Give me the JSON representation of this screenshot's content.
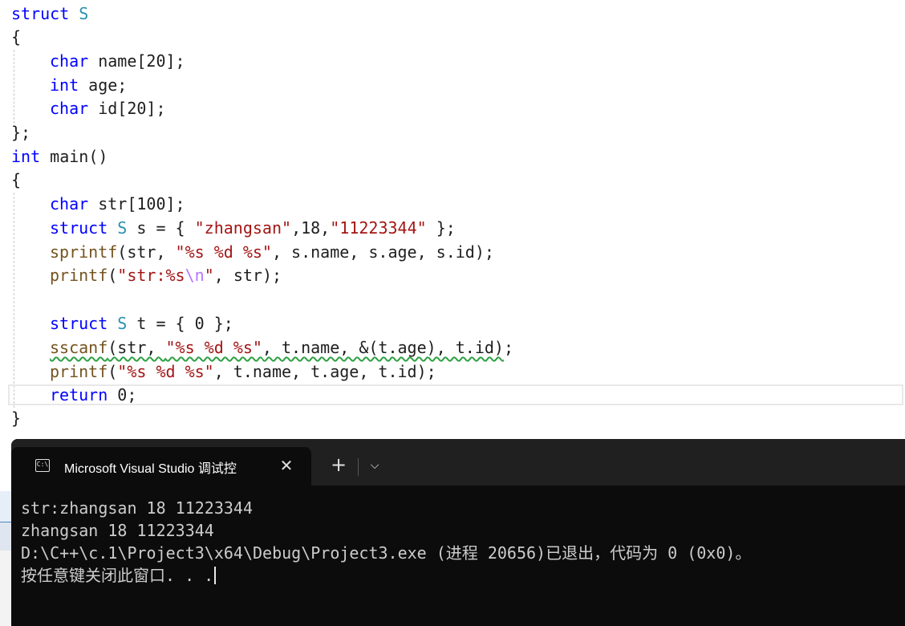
{
  "editor": {
    "lines": [
      {
        "kw": "struct",
        "ty": "S"
      },
      {
        "brace_open": "{"
      },
      {
        "kw": "char",
        "rest": " name[20];"
      },
      {
        "kw": "int",
        "rest": " age;"
      },
      {
        "kw": "char",
        "rest": " id[20];"
      },
      {
        "brace_close": "};"
      },
      {
        "kw": "int",
        "rest": " main()"
      },
      {
        "brace_open": "{"
      },
      {
        "kw": "char",
        "rest": " str[100];"
      },
      {
        "kw": "struct",
        "ty": "S",
        "p1": " s = { ",
        "s1": "\"zhangsan\"",
        "p2": ",18,",
        "s2": "\"11223344\"",
        "p3": " };"
      },
      {
        "fn": "sprintf",
        "p1": "(str, ",
        "s1": "\"%s %d %s\"",
        "p2": ", s.name, s.age, s.id);"
      },
      {
        "fn": "printf",
        "p1": "(",
        "s1": "\"str:%s",
        "esc": "\\n",
        "s2": "\"",
        "p2": ", str);"
      },
      {
        "kw": "struct",
        "ty": "S",
        "p1": " t = { 0 };"
      },
      {
        "fn": "sscanf",
        "p1": "(str, ",
        "s1": "\"%s %d %s\"",
        "p2": ", t.name, &(t.age), t.id)",
        "p3": ";"
      },
      {
        "fn": "printf",
        "p1": "(",
        "s1": "\"%s %d %s\"",
        "p2": ", t.name, t.age, t.id);"
      },
      {
        "kw": "return",
        "rest": " 0;"
      },
      {
        "brace_close": "}"
      }
    ]
  },
  "console": {
    "tab_title": "Microsoft Visual Studio 调试控",
    "tab_icon_text": "C:\\",
    "close_glyph": "✕",
    "new_tab_glyph": "+",
    "dropdown_glyph": "⌵",
    "output": [
      "str:zhangsan 18 11223344",
      "zhangsan 18 11223344",
      "D:\\C++\\c.1\\Project3\\x64\\Debug\\Project3.exe (进程 20656)已退出，代码为 0 (0x0)。",
      "按任意键关闭此窗口. . ."
    ]
  },
  "colors": {
    "keyword": "#0000ff",
    "type": "#2b91af",
    "string": "#a31515",
    "function": "#74531f",
    "escape": "#b776fb",
    "console_bg": "#0c0c0c",
    "console_text": "#cccccc"
  }
}
